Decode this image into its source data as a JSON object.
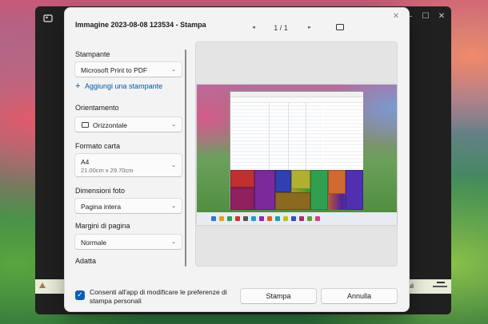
{
  "dialog": {
    "title": "Immagine 2023-08-08 123534 - Stampa",
    "close_glyph": "✕",
    "page_counter": "1 / 1",
    "prev_glyph": "◂",
    "next_glyph": "▸"
  },
  "settings": {
    "printer": {
      "label": "Stampante",
      "value": "Microsoft Print to PDF"
    },
    "add_printer": {
      "plus": "+",
      "label": "Aggiungi una stampante"
    },
    "orientation": {
      "label": "Orientamento",
      "value": "Orizzontale"
    },
    "paper": {
      "label": "Formato carta",
      "value": "A4",
      "size": "21.00cm x 29.70cm"
    },
    "photo_size": {
      "label": "Dimensioni foto",
      "value": "Pagina intera"
    },
    "margins": {
      "label": "Margini di pagina",
      "value": "Normale"
    },
    "fit": {
      "label": "Adatta"
    }
  },
  "footer": {
    "consent_checked": true,
    "consent_text": "Consenti all'app di modificare le preferenze di stampa personali",
    "print_label": "Stampa",
    "cancel_label": "Annulla"
  },
  "background_window": {
    "minimize_glyph": "—",
    "maximize_glyph": "☐",
    "close_glyph": "✕"
  },
  "icons": {
    "chevron": "⌄",
    "check": "✓"
  },
  "colors": {
    "accent": "#0a5fb8",
    "link": "#0057a6",
    "dialog_bg": "#f3f3f3"
  }
}
